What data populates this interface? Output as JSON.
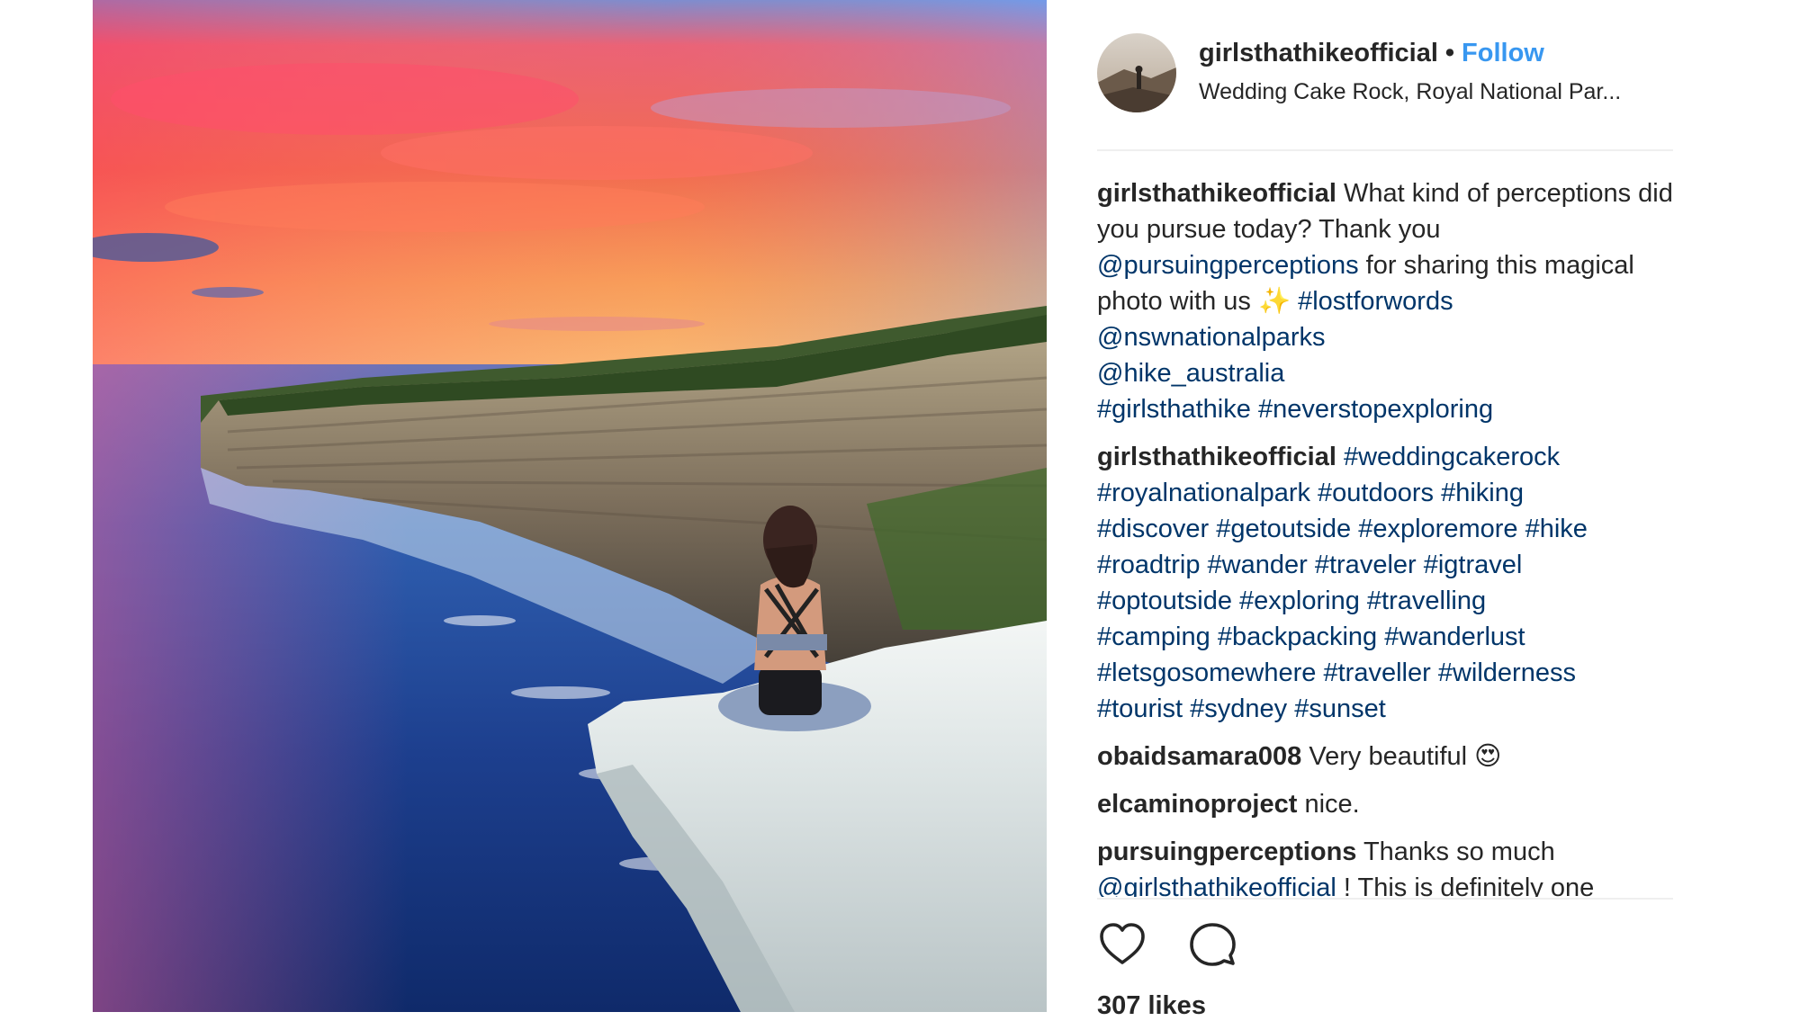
{
  "post": {
    "username": "girlsthathikeofficial",
    "separator": "•",
    "follow_label": "Follow",
    "location": "Wedding Cake Rock, Royal National Par..."
  },
  "comments": [
    {
      "author": "girlsthathikeofficial",
      "segments": [
        {
          "type": "text",
          "value": " What kind of perceptions did you pursue today? Thank you "
        },
        {
          "type": "mention",
          "value": "@pursuingperceptions"
        },
        {
          "type": "text",
          "value": " for sharing this magical photo with us ✨ "
        },
        {
          "type": "tag",
          "value": "#lostforwords"
        },
        {
          "type": "break"
        },
        {
          "type": "mention",
          "value": "@nswnationalparks"
        },
        {
          "type": "break"
        },
        {
          "type": "mention",
          "value": "@hike_australia"
        },
        {
          "type": "break"
        },
        {
          "type": "tag",
          "value": "#girlsthathike"
        },
        {
          "type": "text",
          "value": " "
        },
        {
          "type": "tag",
          "value": "#neverstopexploring"
        }
      ]
    },
    {
      "author": "girlsthathikeofficial",
      "segments": [
        {
          "type": "text",
          "value": " "
        },
        {
          "type": "tag",
          "value": "#weddingcakerock"
        },
        {
          "type": "break"
        },
        {
          "type": "tag",
          "value": "#royalnationalpark"
        },
        {
          "type": "text",
          "value": " "
        },
        {
          "type": "tag",
          "value": "#outdoors"
        },
        {
          "type": "text",
          "value": " "
        },
        {
          "type": "tag",
          "value": "#hiking"
        },
        {
          "type": "break"
        },
        {
          "type": "tag",
          "value": "#discover"
        },
        {
          "type": "text",
          "value": " "
        },
        {
          "type": "tag",
          "value": "#getoutside"
        },
        {
          "type": "text",
          "value": " "
        },
        {
          "type": "tag",
          "value": "#exploremore"
        },
        {
          "type": "text",
          "value": " "
        },
        {
          "type": "tag",
          "value": "#hike"
        },
        {
          "type": "break"
        },
        {
          "type": "tag",
          "value": "#roadtrip"
        },
        {
          "type": "text",
          "value": " "
        },
        {
          "type": "tag",
          "value": "#wander"
        },
        {
          "type": "text",
          "value": " "
        },
        {
          "type": "tag",
          "value": "#traveler"
        },
        {
          "type": "text",
          "value": " "
        },
        {
          "type": "tag",
          "value": "#igtravel"
        },
        {
          "type": "break"
        },
        {
          "type": "tag",
          "value": "#optoutside"
        },
        {
          "type": "text",
          "value": " "
        },
        {
          "type": "tag",
          "value": "#exploring"
        },
        {
          "type": "text",
          "value": " "
        },
        {
          "type": "tag",
          "value": "#travelling"
        },
        {
          "type": "break"
        },
        {
          "type": "tag",
          "value": "#camping"
        },
        {
          "type": "text",
          "value": " "
        },
        {
          "type": "tag",
          "value": "#backpacking"
        },
        {
          "type": "text",
          "value": " "
        },
        {
          "type": "tag",
          "value": "#wanderlust"
        },
        {
          "type": "break"
        },
        {
          "type": "tag",
          "value": "#letsgosomewhere"
        },
        {
          "type": "text",
          "value": " "
        },
        {
          "type": "tag",
          "value": "#traveller"
        },
        {
          "type": "text",
          "value": " "
        },
        {
          "type": "tag",
          "value": "#wilderness"
        },
        {
          "type": "break"
        },
        {
          "type": "tag",
          "value": "#tourist"
        },
        {
          "type": "text",
          "value": " "
        },
        {
          "type": "tag",
          "value": "#sydney"
        },
        {
          "type": "text",
          "value": " "
        },
        {
          "type": "tag",
          "value": "#sunset"
        }
      ]
    },
    {
      "author": "obaidsamara008",
      "segments": [
        {
          "type": "text",
          "value": " Very beautiful 😍"
        }
      ]
    },
    {
      "author": "elcaminoproject",
      "segments": [
        {
          "type": "text",
          "value": " nice."
        }
      ]
    },
    {
      "author": "pursuingperceptions",
      "segments": [
        {
          "type": "text",
          "value": " Thanks so much "
        },
        {
          "type": "mention",
          "value": "@girlsthathikeofficial"
        },
        {
          "type": "text",
          "value": " ! This is definitely one"
        }
      ]
    }
  ],
  "actions": {
    "like_icon": "heart-outline-icon",
    "comment_icon": "comment-bubble-icon"
  },
  "likes_text": "307 likes",
  "colors": {
    "link": "#003569",
    "follow": "#3897f0",
    "text": "#262626",
    "divider": "#efefef"
  }
}
